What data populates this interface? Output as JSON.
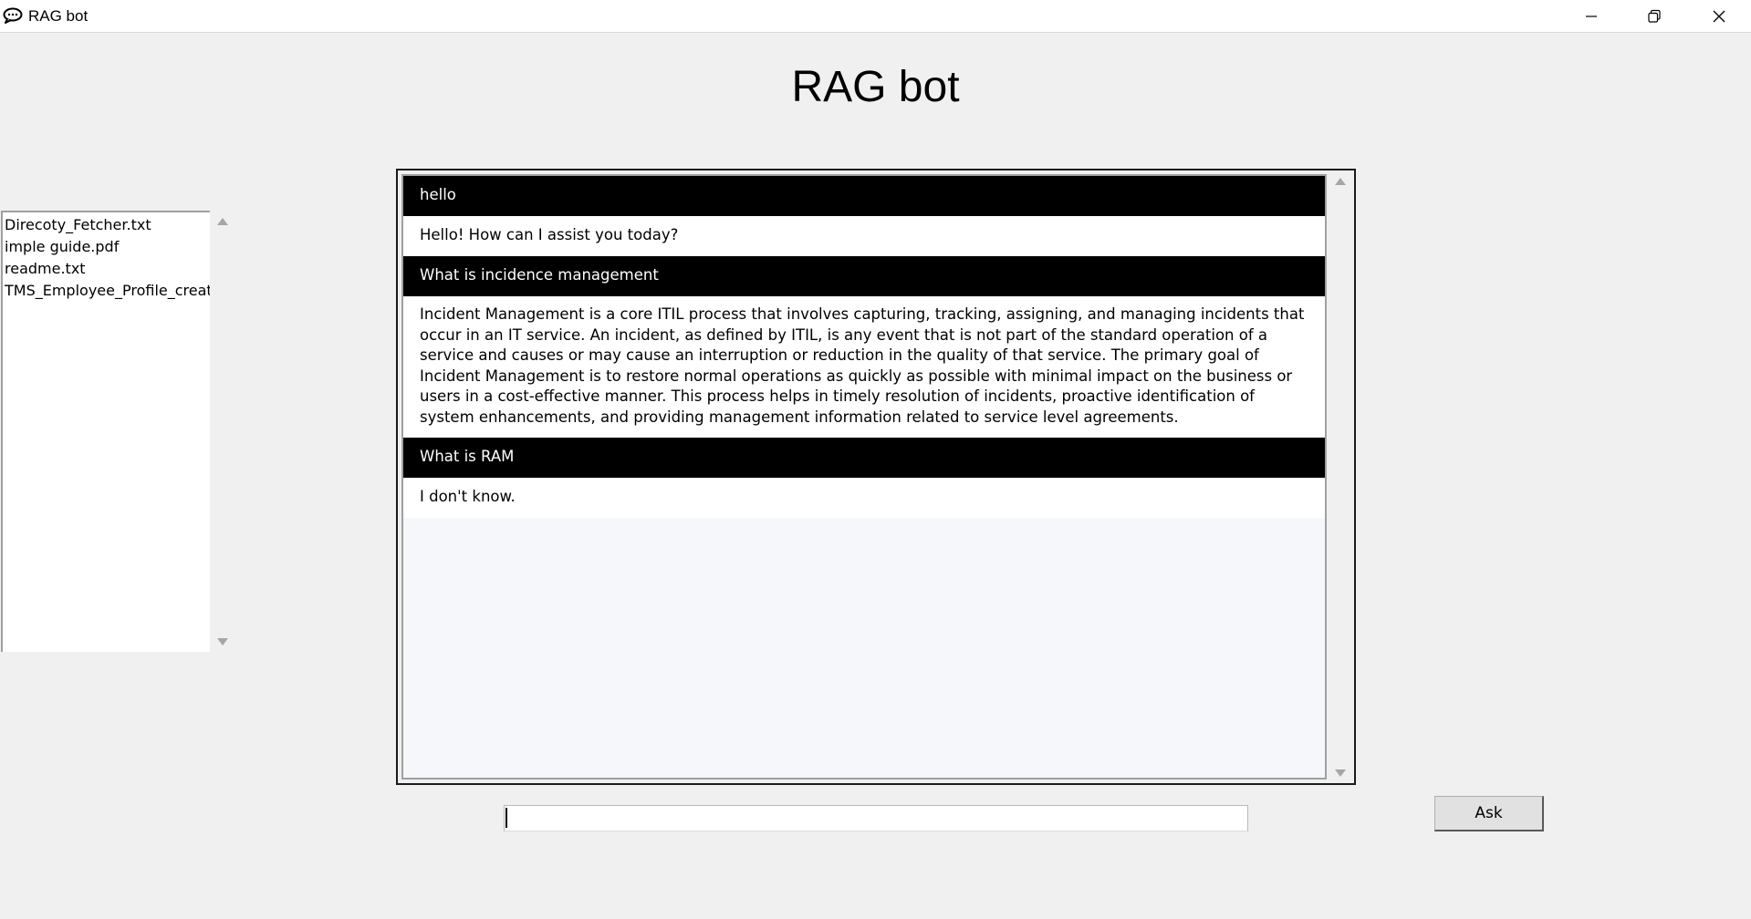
{
  "window": {
    "title": "RAG bot",
    "minimize_glyph": "—",
    "restore_glyph": "❐",
    "close_glyph": "✕"
  },
  "heading": "RAG bot",
  "files": [
    "Direcoty_Fetcher.txt",
    "imple guide.pdf",
    "readme.txt",
    "TMS_Employee_Profile_creat"
  ],
  "conversation": [
    {
      "role": "user",
      "text": "hello"
    },
    {
      "role": "bot",
      "text": "Hello! How can I assist you today?"
    },
    {
      "role": "user",
      "text": "What is incidence management"
    },
    {
      "role": "bot",
      "text": "Incident Management is a core ITIL process that involves capturing, tracking, assigning, and managing incidents that occur in an IT service. An incident, as defined by ITIL, is any event that is not part of the standard operation of a service and causes or may cause an interruption or reduction in the quality of that service. The primary goal of Incident Management is to restore normal operations as quickly as possible with minimal impact on the business or users in a cost-effective manner. This process helps in timely resolution of incidents, proactive identification of system enhancements, and providing management information related to service level agreements."
    },
    {
      "role": "user",
      "text": "What is RAM"
    },
    {
      "role": "bot",
      "text": "I don't know."
    }
  ],
  "input": {
    "value": "",
    "placeholder": ""
  },
  "ask_button": "Ask",
  "colors": {
    "background": "#f0f0f0",
    "user_message_bg": "#000000",
    "user_message_text": "#ffffff",
    "bot_message_bg": "#ffffff"
  }
}
